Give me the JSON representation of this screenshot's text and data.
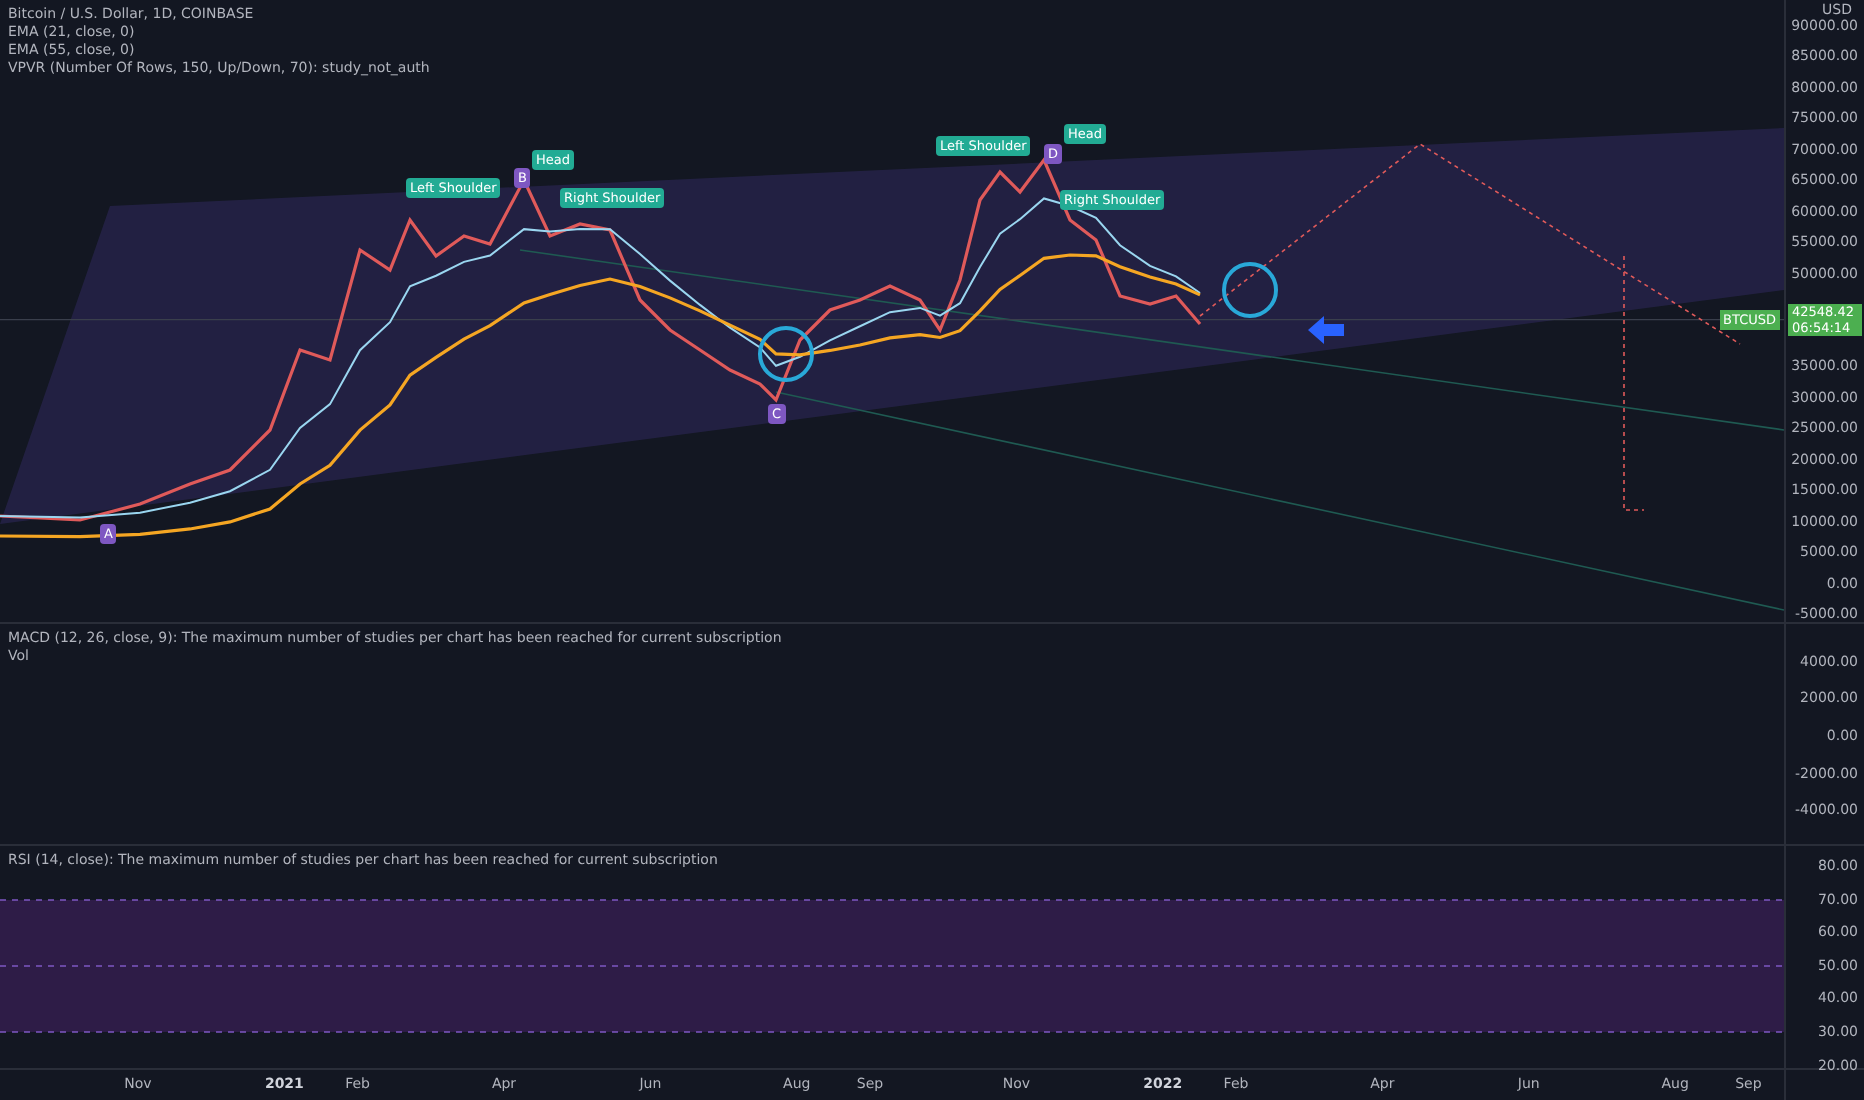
{
  "main_pane": {
    "legend": [
      "Bitcoin / U.S. Dollar, 1D, COINBASE",
      "EMA (21, close, 0)",
      "EMA (55, close, 0)",
      "VPVR (Number Of Rows, 150, Up/Down, 70): study_not_auth"
    ],
    "unit": "USD",
    "ticks": [
      "90000.00",
      "85000.00",
      "80000.00",
      "75000.00",
      "70000.00",
      "65000.00",
      "60000.00",
      "55000.00",
      "50000.00",
      "35000.00",
      "30000.00",
      "25000.00",
      "20000.00",
      "15000.00",
      "10000.00",
      "5000.00",
      "0.00",
      "-5000.00"
    ],
    "pattern_labels": [
      "Left Shoulder",
      "Head",
      "Right Shoulder",
      "Left Shoulder",
      "Head",
      "Right Shoulder"
    ],
    "points": [
      "A",
      "B",
      "C",
      "D"
    ],
    "price_label": {
      "symbol": "BTCUSD",
      "price": "42548.42",
      "countdown": "06:54:14"
    }
  },
  "macd_pane": {
    "legend": [
      "MACD (12, 26, close, 9): The maximum number of studies per chart has been reached for current subscription",
      "Vol"
    ],
    "ticks": [
      "4000.00",
      "2000.00",
      "0.00",
      "-2000.00",
      "-4000.00"
    ]
  },
  "rsi_pane": {
    "legend": [
      "RSI (14, close): The maximum number of studies per chart has been reached for current subscription"
    ],
    "ticks": [
      "80.00",
      "70.00",
      "60.00",
      "50.00",
      "40.00",
      "30.00",
      "20.00"
    ]
  },
  "time_axis": [
    {
      "text": "Nov",
      "kind": "month"
    },
    {
      "text": "2021",
      "kind": "year"
    },
    {
      "text": "Feb",
      "kind": "month"
    },
    {
      "text": "Apr",
      "kind": "month"
    },
    {
      "text": "Jun",
      "kind": "month"
    },
    {
      "text": "Aug",
      "kind": "month"
    },
    {
      "text": "Sep",
      "kind": "month"
    },
    {
      "text": "Nov",
      "kind": "month"
    },
    {
      "text": "2022",
      "kind": "year"
    },
    {
      "text": "Feb",
      "kind": "month"
    },
    {
      "text": "Apr",
      "kind": "month"
    },
    {
      "text": "Jun",
      "kind": "month"
    },
    {
      "text": "Aug",
      "kind": "month"
    },
    {
      "text": "Sep",
      "kind": "month"
    }
  ]
}
